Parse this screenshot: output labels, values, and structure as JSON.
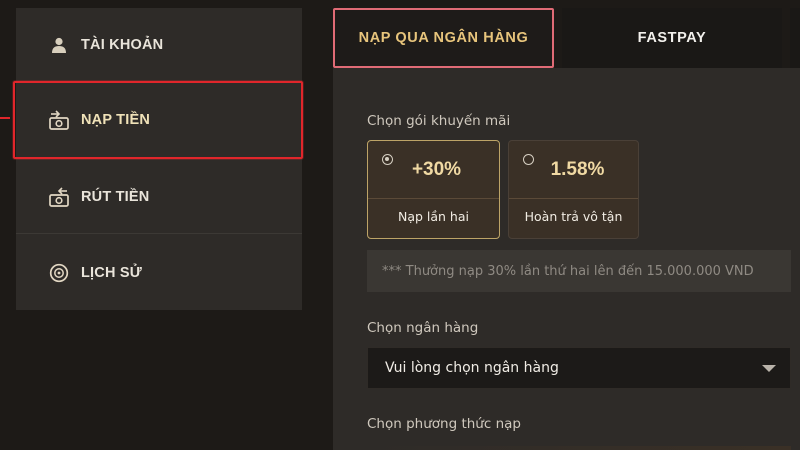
{
  "sidebar": {
    "items": [
      {
        "label": "TÀI KHOẢN",
        "icon": "user-icon"
      },
      {
        "label": "NẠP TIỀN",
        "icon": "deposit-cash-icon",
        "active": true
      },
      {
        "label": "RÚT TIỀN",
        "icon": "withdraw-cash-icon"
      },
      {
        "label": "LỊCH SỬ",
        "icon": "history-coin-icon"
      }
    ]
  },
  "tabs": [
    {
      "label": "NẠP QUA NGÂN HÀNG",
      "active": true
    },
    {
      "label": "FASTPAY",
      "active": false
    }
  ],
  "promo": {
    "label": "Chọn gói khuyến mãi",
    "options": [
      {
        "value": "+30%",
        "caption": "Nạp lần hai",
        "selected": true
      },
      {
        "value": "1.58%",
        "caption": "Hoàn trả vô tận",
        "selected": false
      }
    ],
    "note": "*** Thưởng nạp 30% lần thứ hai lên đến 15.000.000 VND"
  },
  "bank": {
    "label": "Chọn ngân hàng",
    "placeholder": "Vui lòng chọn ngân hàng"
  },
  "method": {
    "label": "Chọn phương thức nạp"
  },
  "colors": {
    "accent_gold": "#e8c57c",
    "highlight_red": "#e0262b",
    "panel_bg": "#2e2b28",
    "page_bg": "#1d1a17"
  }
}
